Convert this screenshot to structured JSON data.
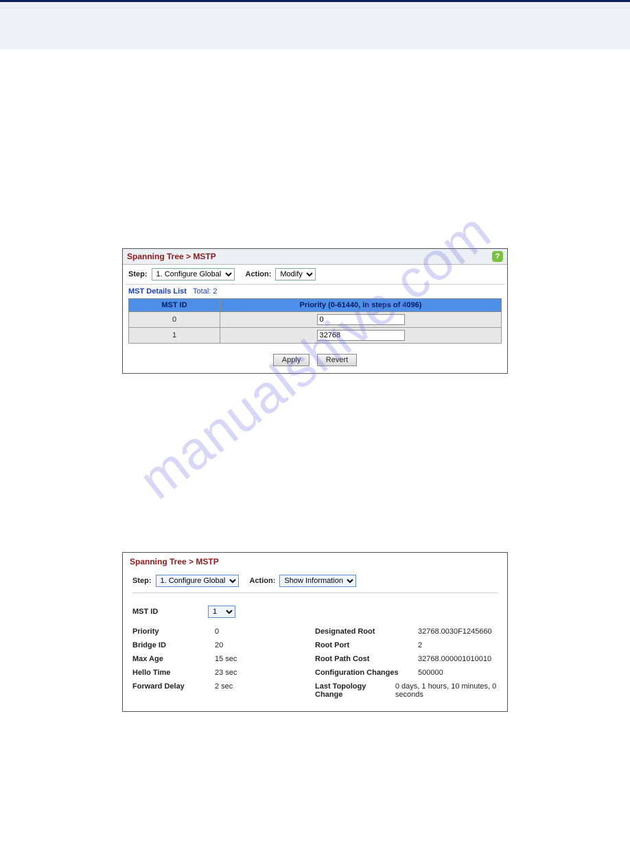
{
  "watermark": "manualshive.com",
  "panel1": {
    "breadcrumb": "Spanning Tree > MSTP",
    "step_label": "Step:",
    "step_value": "1. Configure Global",
    "action_label": "Action:",
    "action_value": "Modify",
    "list_title": "MST Details List",
    "list_total_label": "Total:",
    "list_total": "2",
    "col_mstid": "MST ID",
    "col_priority": "Priority (0-61440, in steps of 4096)",
    "rows": [
      {
        "mstid": "0",
        "priority": "0"
      },
      {
        "mstid": "1",
        "priority": "32768"
      }
    ],
    "apply": "Apply",
    "revert": "Revert"
  },
  "panel2": {
    "breadcrumb": "Spanning Tree > MSTP",
    "step_label": "Step:",
    "step_value": "1. Configure Global",
    "action_label": "Action:",
    "action_value": "Show Information",
    "mstid_label": "MST ID",
    "mstid_value": "1",
    "left": {
      "priority_k": "Priority",
      "priority_v": "0",
      "bridgeid_k": "Bridge ID",
      "bridgeid_v": "20",
      "maxage_k": "Max Age",
      "maxage_v": "15 sec",
      "hello_k": "Hello Time",
      "hello_v": "23 sec",
      "fwd_k": "Forward Delay",
      "fwd_v": "2 sec"
    },
    "right": {
      "desroot_k": "Designated Root",
      "desroot_v": "32768.0030F1245660",
      "rootport_k": "Root Port",
      "rootport_v": "2",
      "rootcost_k": "Root Path Cost",
      "rootcost_v": "32768.000001010010",
      "cfg_k": "Configuration Changes",
      "cfg_v": "500000",
      "topo_k": "Last Topology Change",
      "topo_v": "0 days, 1 hours, 10 minutes, 0 seconds"
    }
  }
}
